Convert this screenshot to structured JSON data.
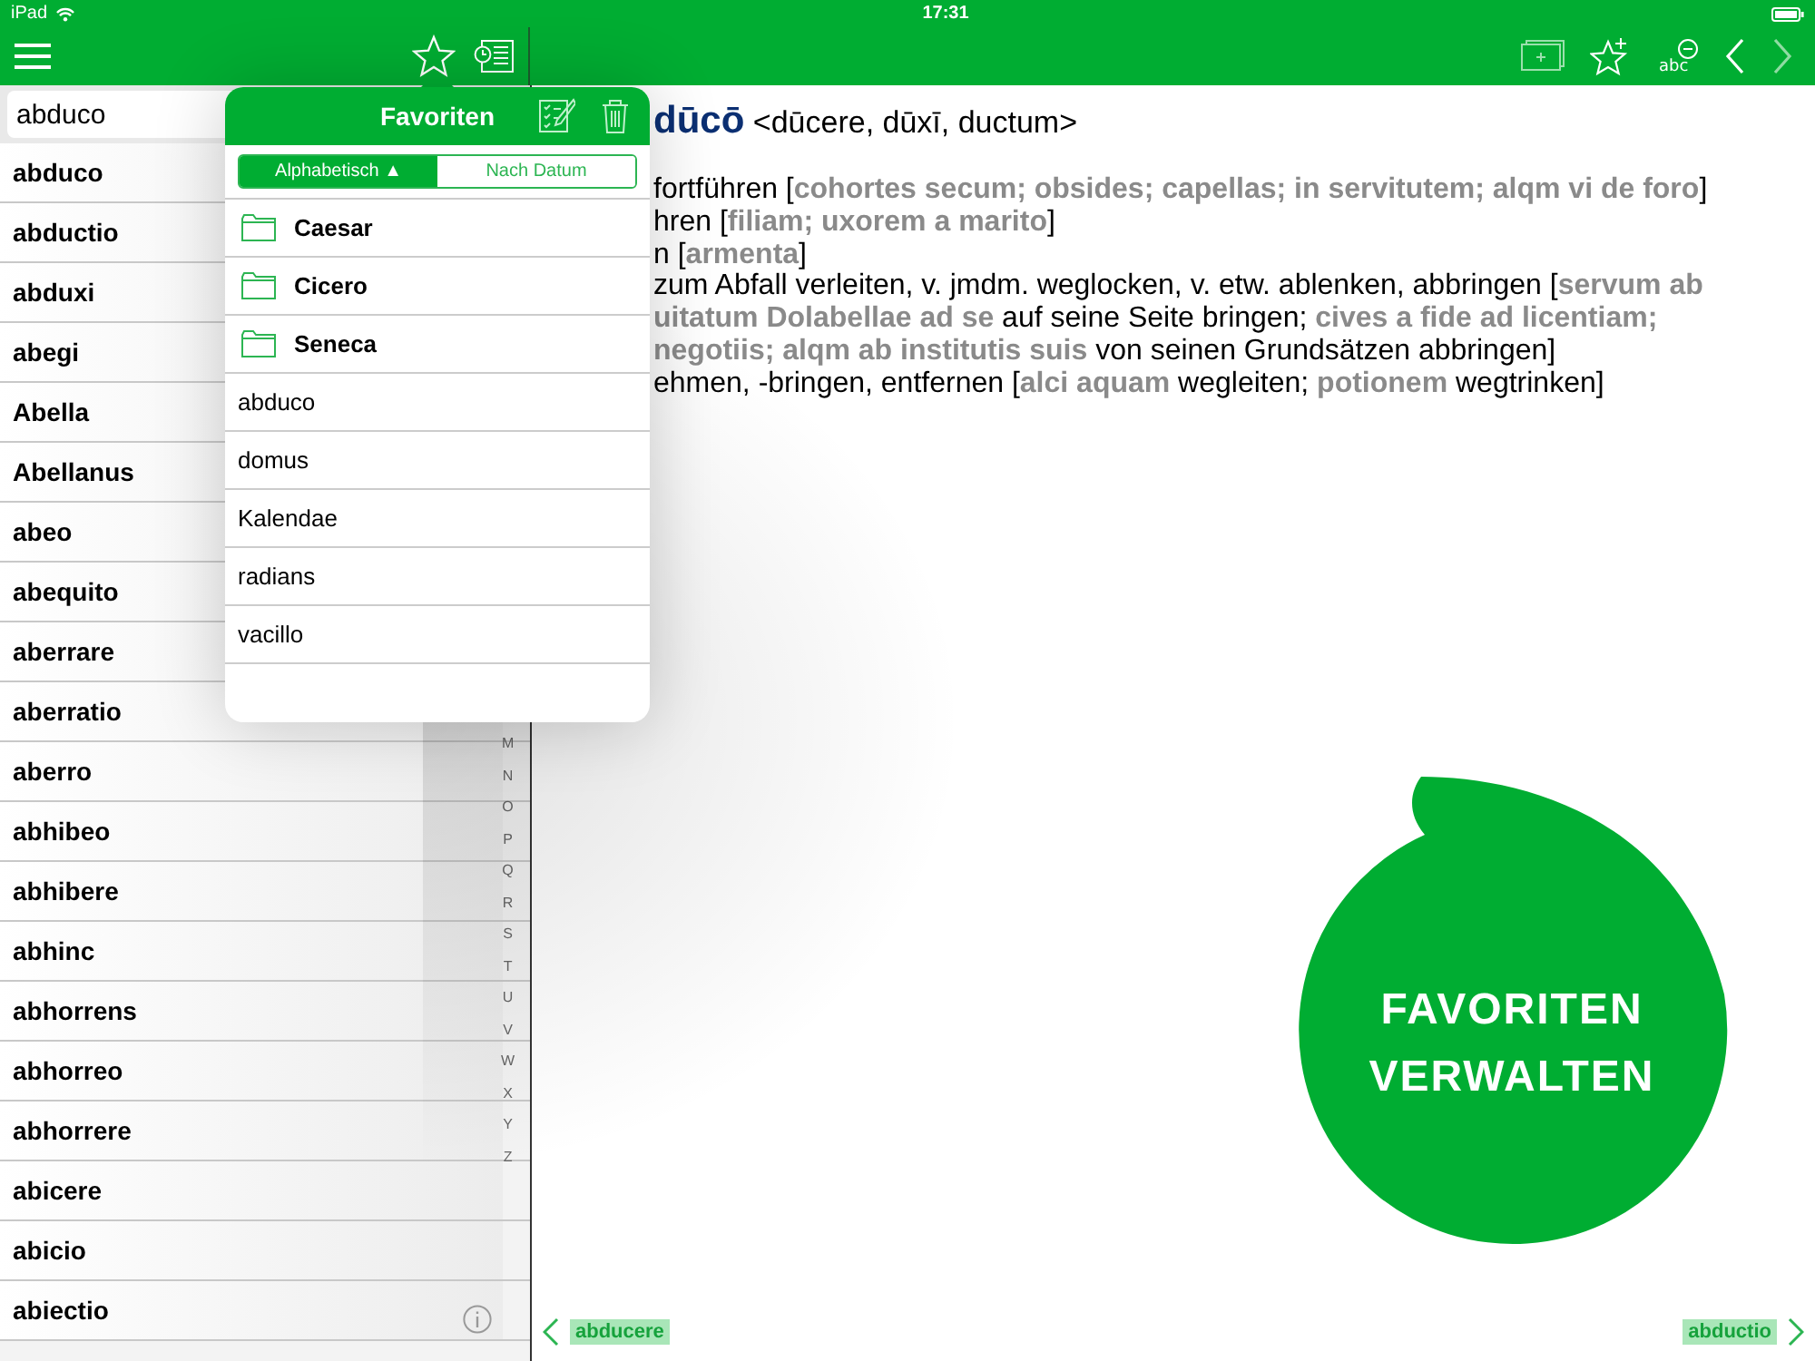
{
  "status_bar": {
    "device": "iPad",
    "time": "17:31"
  },
  "toolbar": {
    "text_size_label": "abc"
  },
  "search": {
    "value": "abduco"
  },
  "word_list": [
    "abduco",
    "abductio",
    "abduxi",
    "abegi",
    "Abella",
    "Abellanus",
    "abeo",
    "abequito",
    "aberrare",
    "aberratio",
    "aberro",
    "abhibeo",
    "abhibere",
    "abhinc",
    "abhorrens",
    "abhorreo",
    "abhorrere",
    "abicere",
    "abicio",
    "abiectio"
  ],
  "index_letters": [
    "M",
    "N",
    "O",
    "P",
    "Q",
    "R",
    "S",
    "T",
    "U",
    "V",
    "W",
    "X",
    "Y",
    "Z"
  ],
  "favorites_popover": {
    "title": "Favoriten",
    "sort_tabs": [
      {
        "label": "Alphabetisch ▲",
        "selected": true
      },
      {
        "label": "Nach Datum",
        "selected": false
      }
    ],
    "items": [
      {
        "kind": "folder",
        "label": "Caesar"
      },
      {
        "kind": "folder",
        "label": "Cicero"
      },
      {
        "kind": "folder",
        "label": "Seneca"
      },
      {
        "kind": "word",
        "label": "abduco"
      },
      {
        "kind": "word",
        "label": "domus"
      },
      {
        "kind": "word",
        "label": "Kalendae"
      },
      {
        "kind": "word",
        "label": "radians"
      },
      {
        "kind": "word",
        "label": "vacillo"
      }
    ]
  },
  "entry": {
    "headword": "dūcō",
    "forms": "<dūcere, dūxī, ductum>",
    "lines": [
      "fortführen [**cohortes secum; obsides; capellas; in servitutem; alqm vi de foro**]",
      "hren [**filiam; uxorem a marito**]",
      "n [**armenta**]",
      "zum Abfall verleiten, v. jmdm. weglocken, v. etw. ablenken, abbringen [**servum ab**",
      "**uitatum Dolabellae ad se** auf seine Seite bringen; **cives a fide ad licentiam;**",
      "**negotiis; alqm ab institutis suis** von seinen Grundsätzen abbringen]",
      "ehmen, -bringen, entfernen [**alci aquam** wegleiten; **potionem** wegtrinken]"
    ]
  },
  "tip_bubble": {
    "lines": [
      "FAVORITEN",
      "VERWALTEN"
    ]
  },
  "footer": {
    "previous": "abducere",
    "next": "abductio"
  }
}
